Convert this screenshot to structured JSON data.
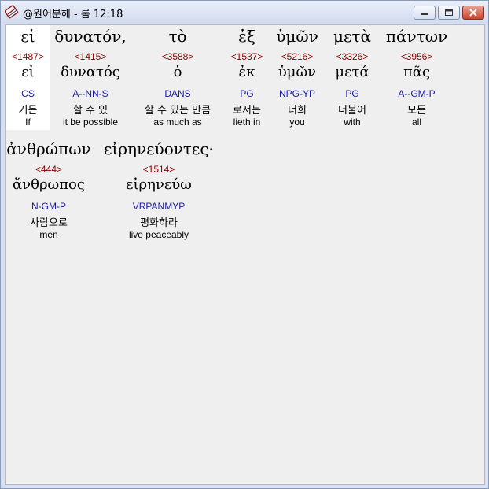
{
  "window": {
    "title": "@원어분해 - 롬 12:18",
    "icon": "bible-app-icon",
    "controls": [
      "minimize-icon",
      "maximize-icon",
      "close-icon"
    ]
  },
  "colors": {
    "strongs": "#8b0000",
    "parsing": "#1a1aa8",
    "text": "#000000",
    "background": "#efefef"
  },
  "words": [
    {
      "greek": "εἰ",
      "strongs": "<1487>",
      "lemma": "εἰ",
      "parsing": "CS",
      "korean": "거든",
      "english": "If"
    },
    {
      "greek": "δυνατόν,",
      "strongs": "<1415>",
      "lemma": "δυνατός",
      "parsing": "A--NN-S",
      "korean": "할 수 있",
      "english": "it be possible"
    },
    {
      "greek": "τὸ",
      "strongs": "<3588>",
      "lemma": "ὁ",
      "parsing": "DANS",
      "korean": "할 수 있는 만큼",
      "english": "as much as"
    },
    {
      "greek": "ἐξ",
      "strongs": "<1537>",
      "lemma": "ἐκ",
      "parsing": "PG",
      "korean": "로서는",
      "english": "lieth in"
    },
    {
      "greek": "ὑμῶν",
      "strongs": "<5216>",
      "lemma": "ὑμῶν",
      "parsing": "NPG-YP",
      "korean": "너희",
      "english": "you"
    },
    {
      "greek": "μετὰ",
      "strongs": "<3326>",
      "lemma": "μετά",
      "parsing": "PG",
      "korean": "더불어",
      "english": "with"
    },
    {
      "greek": "πάντων",
      "strongs": "<3956>",
      "lemma": "πᾶς",
      "parsing": "A--GM-P",
      "korean": "모든",
      "english": "all"
    },
    {
      "greek": "ἀνθρώπων",
      "strongs": "<444>",
      "lemma": "ἄνθρωπος",
      "parsing": "N-GM-P",
      "korean": "사람으로",
      "english": "men"
    },
    {
      "greek": "εἰρηνεύοντες·",
      "strongs": "<1514>",
      "lemma": "εἰρηνεύω",
      "parsing": "VRPANMYP",
      "korean": "평화하라",
      "english": "live peaceably"
    }
  ]
}
